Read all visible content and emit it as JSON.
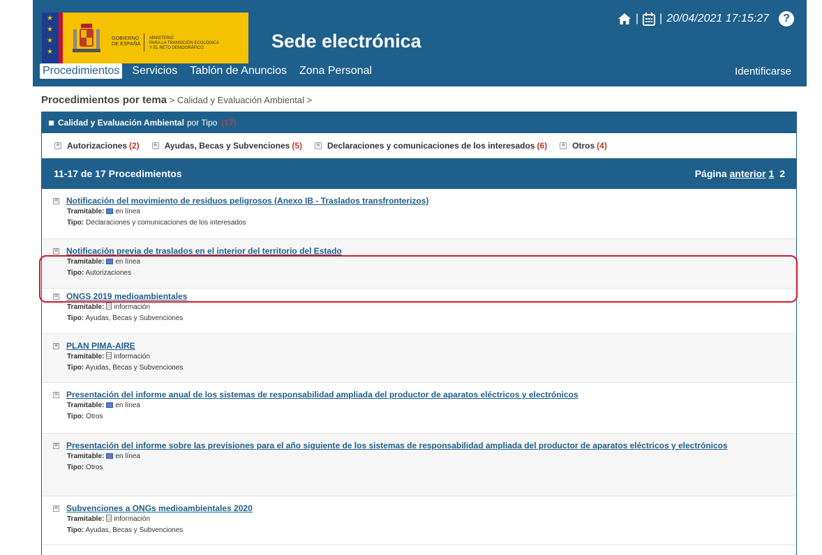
{
  "header": {
    "logo_gob_line1": "GOBIERNO",
    "logo_gob_line2": "DE ESPAÑA",
    "logo_min_line1": "MINISTERIO",
    "logo_min_line2": "PARA LA TRANSICIÓN ECOLÓGICA",
    "logo_min_line3": "Y EL RETO DEMOGRÁFICO",
    "site_title": "Sede electrónica",
    "separator": "|",
    "datetime": "20/04/2021 17:15:27",
    "help_glyph": "?",
    "nav": [
      "Procedimientos",
      "Servicios",
      "Tablón de Anuncios",
      "Zona Personal"
    ],
    "login": "Identificarse"
  },
  "breadcrumb": {
    "root": "Procedimientos por tema",
    "rest": " > Calidad y Evaluación Ambiental >"
  },
  "type_panel": {
    "title": "Calidad y Evaluación Ambiental",
    "suffix": "por Tipo",
    "count": "(17)"
  },
  "filters": [
    {
      "label": "Autorizaciones",
      "count": "(2)"
    },
    {
      "label": "Ayudas, Becas y Subvenciones",
      "count": "(5)"
    },
    {
      "label": "Declaraciones y comunicaciones de los interesados",
      "count": "(6)"
    },
    {
      "label": "Otros",
      "count": "(4)"
    }
  ],
  "list_header": {
    "summary": "11-17 de 17 Procedimientos",
    "page_label": "Página",
    "prev": "anterior",
    "page1": "1",
    "page2": "2"
  },
  "labels": {
    "tramitable": "Tramitable:",
    "tipo": "Tipo:"
  },
  "items": [
    {
      "title": "Notificación del movimiento de residuos peligrosos (Anexo IB - Traslados transfronterizos)",
      "tramitable": "en línea",
      "icon": "computer-icon",
      "tipo": "Declaraciones y comunicaciones de los interesados"
    },
    {
      "title": "Notificación previa de traslados en el interior del territorio del Estado",
      "tramitable": "en línea",
      "icon": "computer-icon",
      "tipo": "Autorizaciones"
    },
    {
      "title": "ONGS 2019 medioambientales",
      "tramitable": "información",
      "icon": "document-icon",
      "tipo": "Ayudas, Becas y Subvenciones"
    },
    {
      "title": "PLAN PIMA-AIRE",
      "tramitable": "información",
      "icon": "document-icon",
      "tipo": "Ayudas, Becas y Subvenciones"
    },
    {
      "title": "Presentación del informe anual de los sistemas de responsabilidad ampliada del productor de aparatos eléctricos y electrónicos",
      "tramitable": "en línea",
      "icon": "computer-icon",
      "tipo": "Otros"
    },
    {
      "title": "Presentación del informe sobre las previsiones para el año siguiente de los sistemas de responsabilidad ampliada del productor de aparatos eléctricos y electrónicos",
      "tramitable": "en línea",
      "icon": "computer-icon",
      "tipo": "Otros"
    },
    {
      "title": "Subvenciones a ONGs medioambientales 2020",
      "tramitable": "información",
      "icon": "document-icon",
      "tipo": "Ayudas, Becas y Subvenciones"
    }
  ],
  "colors": {
    "brand_blue": "#1f5f8b",
    "highlight_red": "#d2182b",
    "count_red": "#c0392b"
  }
}
